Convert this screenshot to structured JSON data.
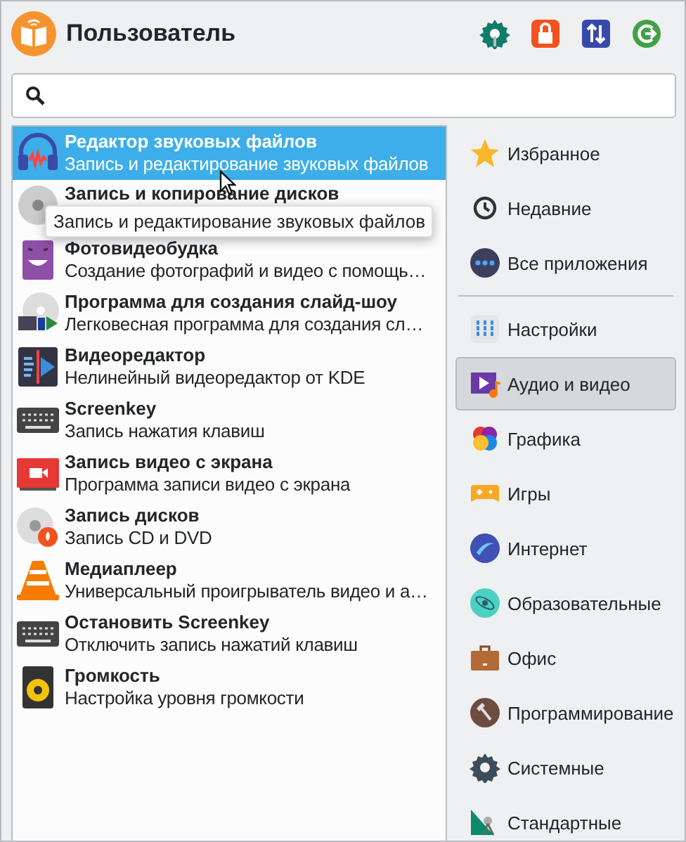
{
  "header": {
    "title": "Пользователь"
  },
  "apps": [
    {
      "title": "Редактор звуковых файлов",
      "description": "Запись и редактирование звуковых файлов",
      "selected": true
    },
    {
      "title": "Запись и копирование дисков",
      "selected": false
    },
    {
      "title": "Фотовидеобудка",
      "description": "Создание фотографий и видео с помощь…",
      "selected": false
    },
    {
      "title": "Программа для создания слайд-шоу",
      "description": "Легковесная программа для создания сл…",
      "selected": false
    },
    {
      "title": "Видеоредактор",
      "description": "Нелинейный видеоредактор от KDE",
      "selected": false
    },
    {
      "title": "Screenkey",
      "description": "Запись нажатия клавиш",
      "selected": false
    },
    {
      "title": "Запись видео с экрана",
      "description": "Программа записи видео с экрана",
      "selected": false
    },
    {
      "title": "Запись дисков",
      "description": "Запись CD и DVD",
      "selected": false
    },
    {
      "title": "Медиаплеер",
      "description": "Универсальный проигрыватель видео и а…",
      "selected": false
    },
    {
      "title": "Остановить Screenkey",
      "description": "Отключить запись нажатий клавиш",
      "selected": false
    },
    {
      "title": "Громкость",
      "description": "Настройка уровня громкости",
      "selected": false
    }
  ],
  "tooltip": "Запись и редактирование звуковых файлов",
  "categories": [
    {
      "label": "Избранное",
      "selected": false
    },
    {
      "label": "Недавние",
      "selected": false
    },
    {
      "label": "Все приложения",
      "selected": false
    },
    {
      "kind": "divider"
    },
    {
      "label": "Настройки",
      "selected": false
    },
    {
      "label": "Аудио и видео",
      "selected": true
    },
    {
      "label": "Графика",
      "selected": false
    },
    {
      "label": "Игры",
      "selected": false
    },
    {
      "label": "Интернет",
      "selected": false
    },
    {
      "label": "Образовательные",
      "selected": false
    },
    {
      "label": "Офис",
      "selected": false
    },
    {
      "label": "Программирование",
      "selected": false
    },
    {
      "label": "Системные",
      "selected": false
    },
    {
      "label": "Стандартные",
      "selected": false
    }
  ]
}
